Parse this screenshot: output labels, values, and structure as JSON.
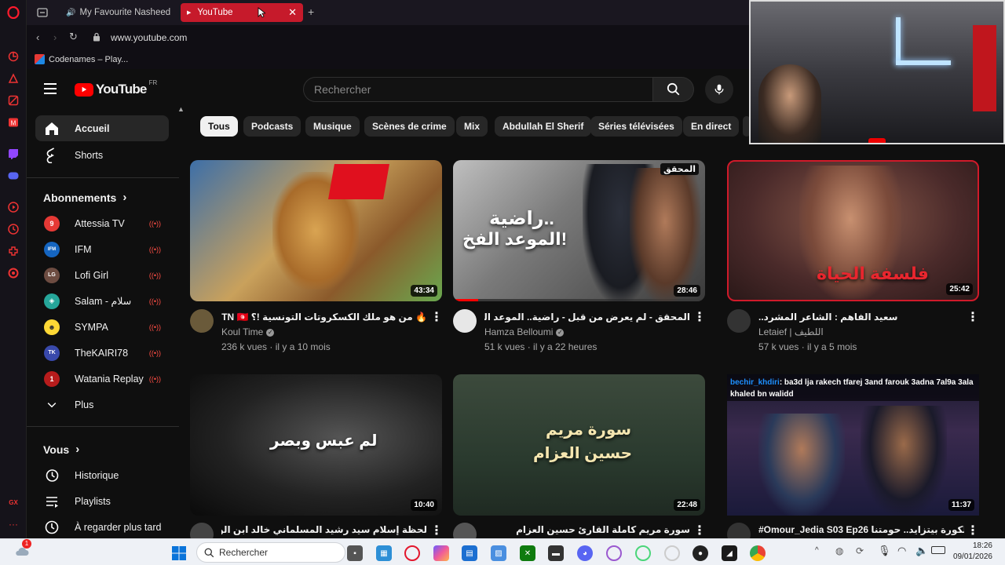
{
  "browser": {
    "tabs": [
      {
        "label": "My Favourite Nasheed"
      },
      {
        "label": "YouTube"
      }
    ],
    "url": "www.youtube.com",
    "bookmark": "Codenames – Play..."
  },
  "youtube": {
    "logo_text": "YouTube",
    "region": "FR",
    "search_placeholder": "Rechercher",
    "sidebar": {
      "main": [
        {
          "label": "Accueil"
        },
        {
          "label": "Shorts"
        }
      ],
      "subscriptions_title": "Abonnements",
      "subscriptions": [
        {
          "label": "Attessia TV",
          "initial": "9",
          "color": "#e53935"
        },
        {
          "label": "IFM",
          "initial": "IFM",
          "color": "#1565c0"
        },
        {
          "label": "Lofi Girl",
          "initial": "LG",
          "color": "#6d4c41"
        },
        {
          "label": "Salam - سلام",
          "initial": "◈",
          "color": "#26a69a"
        },
        {
          "label": "SYMPA",
          "initial": "☻",
          "color": "#fdd835"
        },
        {
          "label": "TheKAIRI78",
          "initial": "TK",
          "color": "#3949ab"
        },
        {
          "label": "Watania Replay",
          "initial": "1",
          "color": "#b71c1c"
        }
      ],
      "more_label": "Plus",
      "you_title": "Vous",
      "you_items": [
        {
          "label": "Historique"
        },
        {
          "label": "Playlists"
        },
        {
          "label": "À regarder plus tard"
        }
      ]
    },
    "chips": [
      "Tous",
      "Podcasts",
      "Musique",
      "Scènes de crime",
      "Mix",
      "Abdullah El Sherif",
      "Séries télévisées",
      "En direct"
    ],
    "videos": [
      {
        "title": "🔥 من هو ملك الكسكروتات التونسية !؟ TN 🇹🇳 👑",
        "channel": "Koul Time",
        "verified": true,
        "views": "236 k vues",
        "age": "il y a 10 mois",
        "duration": "43:34"
      },
      {
        "title": "المحقق - لم يعرض من قبل - راضية.. الموعد الفخ !",
        "channel": "Hamza Belloumi",
        "verified": true,
        "views": "51 k vues",
        "age": "il y a 22 heures",
        "duration": "28:46",
        "thumb_text_1": "راضية..",
        "thumb_text_2": "الموعد الفخ!",
        "thumb_badge": "المحقق"
      },
      {
        "title": "سعيد الفاهم : الشاعر المشرد..",
        "channel": "Letaief | اللطيف",
        "verified": false,
        "views": "57 k vues",
        "age": "il y a 5 mois",
        "duration": "25:42",
        "thumb_text": "فلسفة الحياة"
      },
      {
        "duration": "10:40",
        "thumb_text": "لم عبس وبصر"
      },
      {
        "duration": "22:48",
        "thumb_text_1": "سورة مريم",
        "thumb_text_2": "حسين العزام"
      },
      {
        "duration": "11:37",
        "chat_user": "bechir_khdiri",
        "chat_msg": ": ba3d lja rakech tfarej 3and farouk 3adna 7al9a 3ala khaled bn walidd"
      }
    ],
    "row2_titles_partial": [
      "لحظة إسلام سيد رشيد المسلماني خالد ابن الوليد",
      "سورة مريم كاملة القارئ حسين العزام",
      "#Omour_Jedia S03 Ep26 الكورة بيتزايد.. حومتنا"
    ]
  },
  "taskbar": {
    "search_placeholder": "Rechercher",
    "notif_count": "1",
    "time": "18:26",
    "date": "09/01/2026"
  }
}
